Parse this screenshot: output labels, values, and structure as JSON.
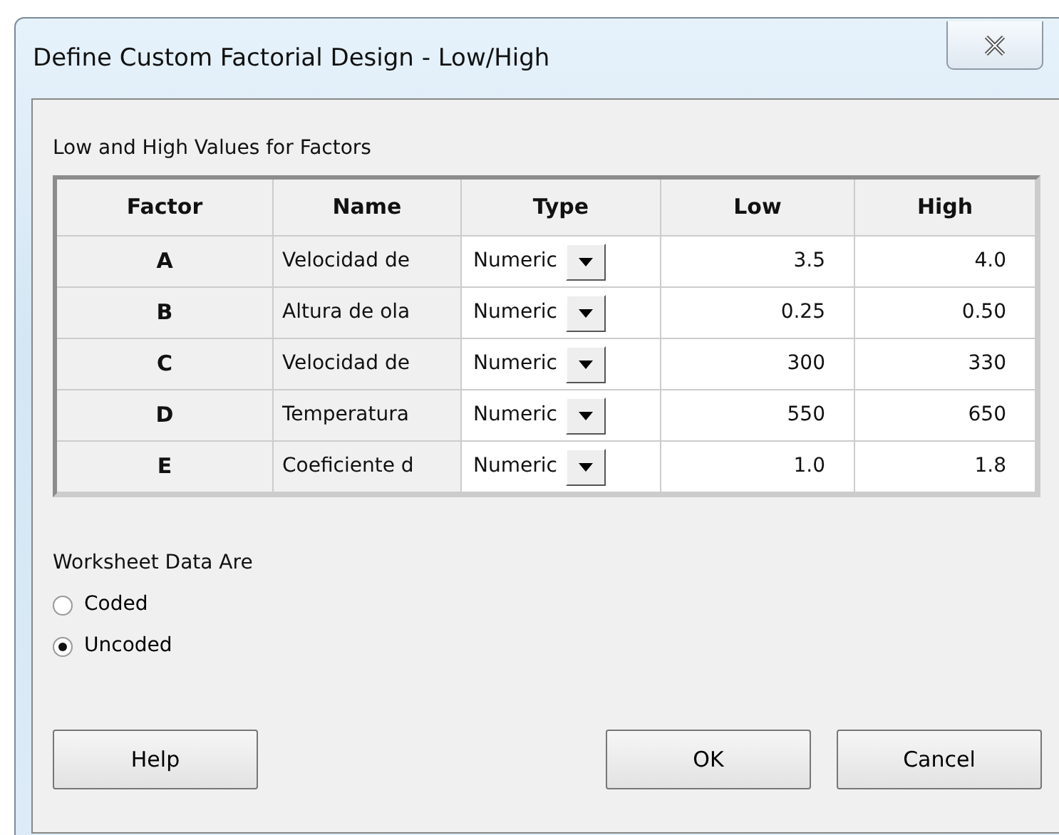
{
  "window": {
    "title": "Define Custom Factorial Design - Low/High"
  },
  "table": {
    "caption": "Low and High Values for Factors",
    "columns": [
      "Factor",
      "Name",
      "Type",
      "Low",
      "High"
    ],
    "rows": [
      {
        "factor": "A",
        "name": "Velocidad de",
        "type": "Numeric",
        "low": "3.5",
        "high": "4.0"
      },
      {
        "factor": "B",
        "name": "Altura de ola",
        "type": "Numeric",
        "low": "0.25",
        "high": "0.50"
      },
      {
        "factor": "C",
        "name": "Velocidad de",
        "type": "Numeric",
        "low": "300",
        "high": "330"
      },
      {
        "factor": "D",
        "name": "Temperatura",
        "type": "Numeric",
        "low": "550",
        "high": "650"
      },
      {
        "factor": "E",
        "name": "Coeficiente d",
        "type": "Numeric",
        "low": "1.0",
        "high": "1.8"
      }
    ]
  },
  "worksheet": {
    "label": "Worksheet Data Are",
    "options": [
      {
        "label": "Coded",
        "selected": false
      },
      {
        "label": "Uncoded",
        "selected": true
      }
    ]
  },
  "buttons": [
    "Help",
    "OK",
    "Cancel"
  ]
}
